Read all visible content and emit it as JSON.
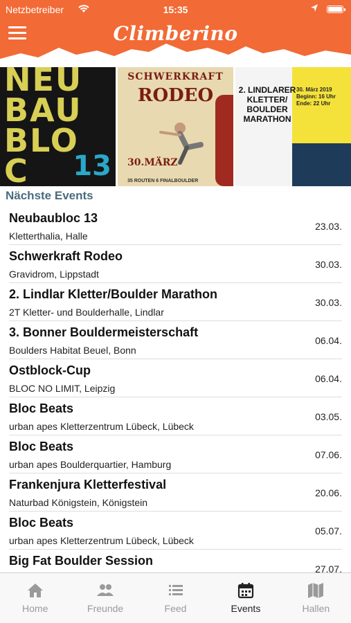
{
  "status_bar": {
    "carrier": "Netzbetreiber",
    "time": "15:35"
  },
  "header": {
    "logo": "Climberino"
  },
  "banner": {
    "posters": [
      {
        "lines": "NEU\nBAU\nBLO\nC",
        "number": "13"
      },
      {
        "line1": "SCHWERKRAFT",
        "line2": "RODEO",
        "date": "30.MÄRZ",
        "footer": "35 ROUTEN  6 FINALBOULDER"
      },
      {
        "title": "2. LINDLARER KLETTER/ BOULDER MARATHON",
        "dateline": "30. März 2019\nBeginn: 16 Uhr\nEnde: 22 Uhr"
      }
    ]
  },
  "section_title": "Nächste Events",
  "events": [
    {
      "name": "Neubaubloc 13",
      "location": "Kletterthalia, Halle",
      "date": "23.03."
    },
    {
      "name": "Schwerkraft Rodeo",
      "location": "Gravidrom, Lippstadt",
      "date": "30.03."
    },
    {
      "name": "2. Lindlar Kletter/Boulder Marathon",
      "location": "2T Kletter- und Boulderhalle, Lindlar",
      "date": "30.03."
    },
    {
      "name": "3. Bonner Bouldermeisterschaft",
      "location": "Boulders Habitat Beuel, Bonn",
      "date": "06.04."
    },
    {
      "name": "Ostblock-Cup",
      "location": "BLOC NO LIMIT, Leipzig",
      "date": "06.04."
    },
    {
      "name": "Bloc Beats",
      "location": "urban apes Kletterzentrum Lübeck, Lübeck",
      "date": "03.05."
    },
    {
      "name": "Bloc Beats",
      "location": "urban apes Boulderquartier, Hamburg",
      "date": "07.06."
    },
    {
      "name": "Frankenjura Kletterfestival",
      "location": "Naturbad Königstein, Königstein",
      "date": "20.06."
    },
    {
      "name": "Bloc Beats",
      "location": "urban apes Kletterzentrum Lübeck, Lübeck",
      "date": "05.07."
    },
    {
      "name": "Big Fat Boulder Session",
      "location": "",
      "date": "27.07."
    }
  ],
  "tabs": [
    {
      "label": "Home",
      "icon": "home-icon",
      "active": false
    },
    {
      "label": "Freunde",
      "icon": "friends-icon",
      "active": false
    },
    {
      "label": "Feed",
      "icon": "list-icon",
      "active": false
    },
    {
      "label": "Events",
      "icon": "calendar-icon",
      "active": true
    },
    {
      "label": "Hallen",
      "icon": "map-icon",
      "active": false
    }
  ],
  "colors": {
    "header": "#f26a35",
    "section_title": "#4a6b7d",
    "tab_inactive": "#9a9a9a",
    "tab_active": "#222222"
  }
}
